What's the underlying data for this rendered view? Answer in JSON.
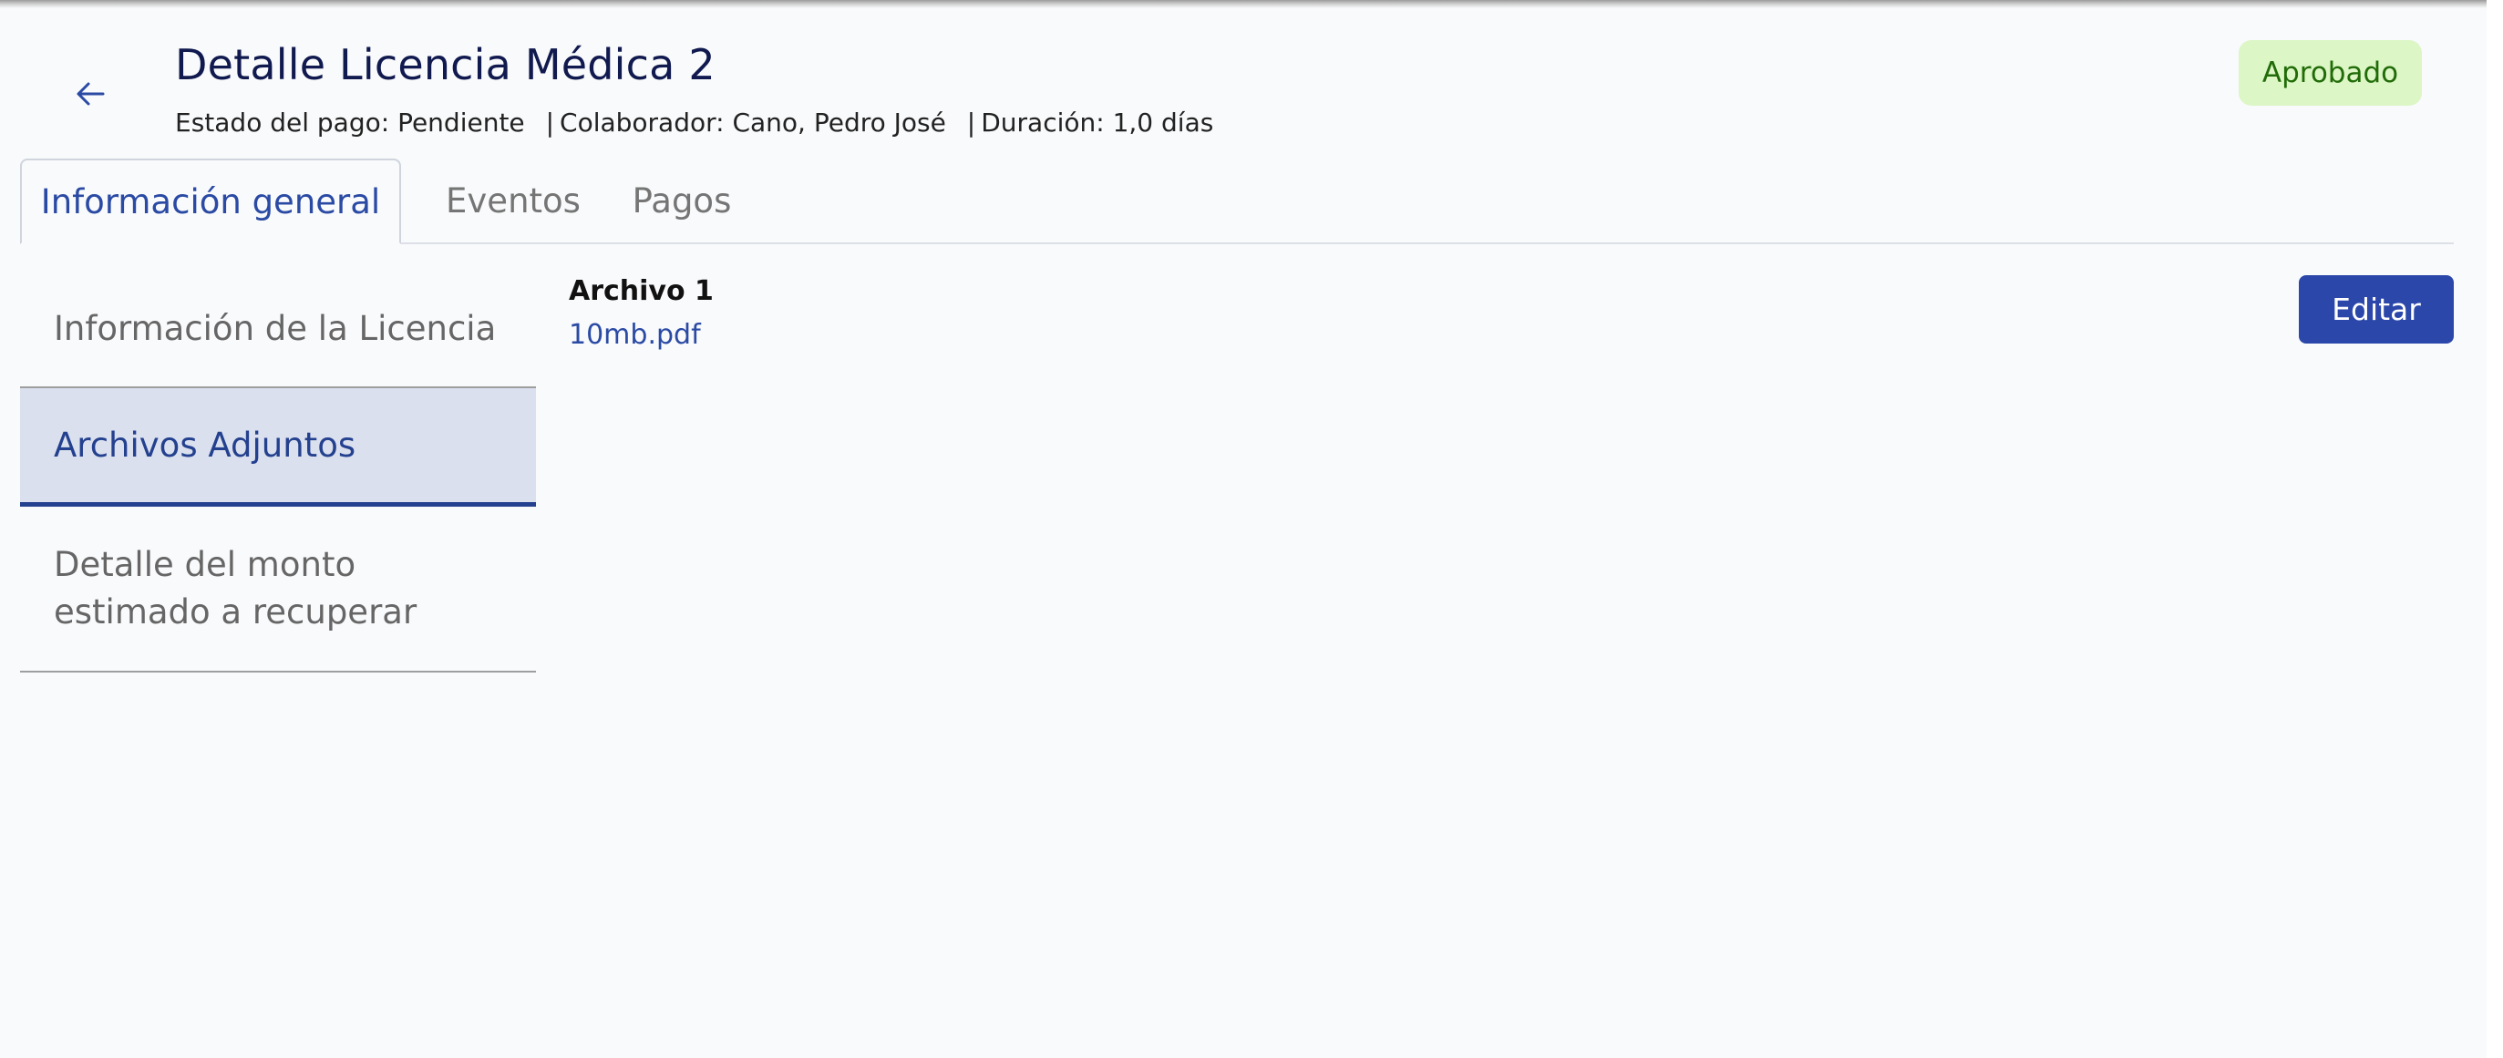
{
  "header": {
    "back_icon": "arrow-left-icon",
    "title": "Detalle Licencia Médica 2",
    "payment_status": "Estado del pago: Pendiente",
    "collaborator": "Colaborador: Cano, Pedro José",
    "duration": "Duración: 1,0 días",
    "separator": "|",
    "status_badge": "Aprobado",
    "badge_bg_color": "#dcf6c6",
    "badge_text_color": "#216b08"
  },
  "tabs": [
    {
      "label": "Información general",
      "active": true
    },
    {
      "label": "Eventos",
      "active": false
    },
    {
      "label": "Pagos",
      "active": false
    }
  ],
  "sidenav": {
    "items": [
      {
        "label": "Información de la Licencia",
        "active": false
      },
      {
        "label": "Archivos Adjuntos",
        "active": true
      },
      {
        "label": "Detalle del monto estimado a recuperar",
        "active": false
      }
    ]
  },
  "attachments": {
    "title": "Archivo 1",
    "file_name": "10mb.pdf",
    "edit_label": "Editar"
  },
  "colors": {
    "accent": "#2b47a9",
    "title": "#111a4f",
    "active_side_bg": "#dbe0ee"
  }
}
